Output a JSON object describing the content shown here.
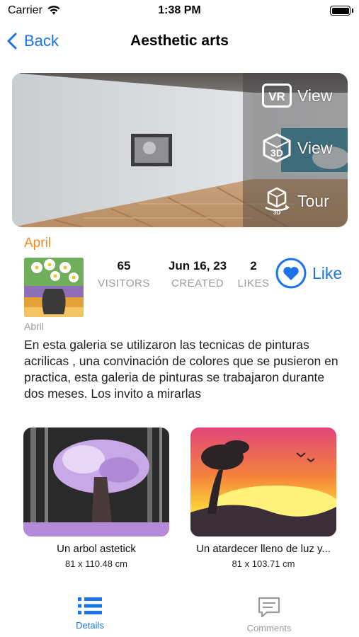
{
  "status_bar": {
    "carrier": "Carrier",
    "time": "1:38 PM"
  },
  "nav": {
    "back_label": "Back",
    "title": "Aesthetic arts"
  },
  "gallery_preview": {
    "view_buttons": [
      {
        "icon": "vr-icon",
        "label": "View"
      },
      {
        "icon": "3d-cube-icon",
        "label": "View"
      },
      {
        "icon": "3d-tour-icon",
        "label": "Tour"
      }
    ]
  },
  "author": {
    "name": "April",
    "caption": "Abril"
  },
  "stats": {
    "visitors": {
      "value": "65",
      "label": "VISITORS"
    },
    "created": {
      "value": "Jun 16, 23",
      "label": "CREATED"
    },
    "likes": {
      "value": "2",
      "label": "LIKES"
    }
  },
  "like_button": {
    "icon": "heart-icon",
    "label": "Like"
  },
  "description": "En esta galeria se utilizaron las tecnicas de pinturas acrilicas , una convinación de colores que se pusieron en practica, esta galeria de pinturas se trabajaron durante dos meses. Los invito a mirarlas",
  "artworks": [
    {
      "title": "Un arbol astetick",
      "size": "81 x 110.48 cm"
    },
    {
      "title": "Un atardecer lleno de luz y...",
      "size": "81 x 103.71 cm"
    }
  ],
  "tab_bar": {
    "tabs": [
      {
        "icon": "list-icon",
        "label": "Details",
        "active": true
      },
      {
        "icon": "comment-icon",
        "label": "Comments",
        "active": false
      }
    ]
  },
  "colors": {
    "accent": "#1a73e8",
    "author_name": "#f08c1e",
    "muted": "#9a9a9a"
  }
}
